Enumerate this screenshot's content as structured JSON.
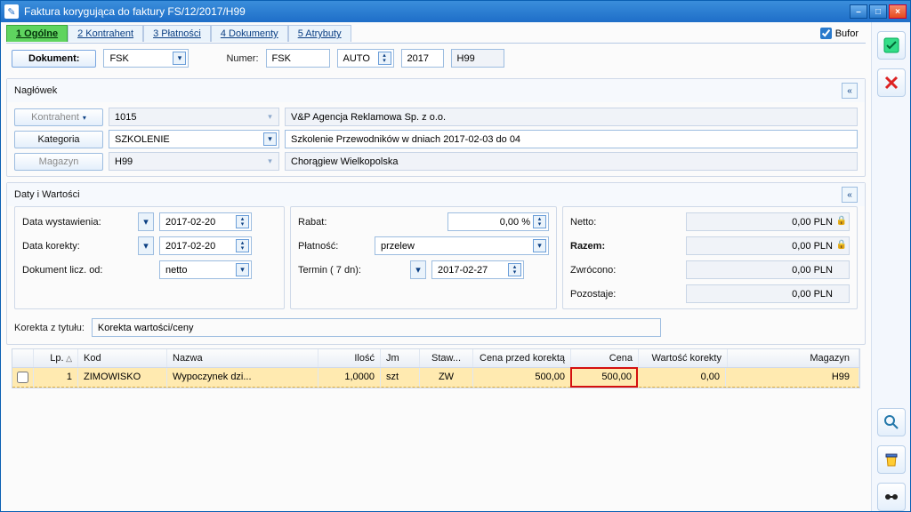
{
  "window": {
    "title": "Faktura korygująca do faktury FS/12/2017/H99"
  },
  "tabs": {
    "t1": "1 Ogólne",
    "t2": "2 Kontrahent",
    "t3": "3 Płatności",
    "t4": "4 Dokumenty",
    "t5": "5 Atrybuty"
  },
  "bufor": {
    "label": "Bufor"
  },
  "docrow": {
    "btn": "Dokument:",
    "type": "FSK",
    "numer_label": "Numer:",
    "num1": "FSK",
    "num2": "AUTO",
    "num3": "2017",
    "num4": "H99"
  },
  "naglowek": {
    "title": "Nagłówek",
    "kontrahent_btn": "Kontrahent",
    "kontrahent_code": "1015",
    "kontrahent_name": "V&P Agencja Reklamowa Sp. z o.o.",
    "kategoria_btn": "Kategoria",
    "kategoria_code": "SZKOLENIE",
    "kategoria_name": "Szkolenie Przewodników w dniach 2017-02-03 do 04",
    "magazyn_btn": "Magazyn",
    "magazyn_code": "H99",
    "magazyn_name": "Chorągiew Wielkopolska"
  },
  "daty": {
    "title": "Daty i Wartości",
    "data_wyst_label": "Data wystawienia:",
    "data_wyst": "2017-02-20",
    "data_kor_label": "Data korekty:",
    "data_kor": "2017-02-20",
    "dok_licz_label": "Dokument licz. od:",
    "dok_licz": "netto",
    "rabat_label": "Rabat:",
    "rabat": "0,00 %",
    "platnosc_label": "Płatność:",
    "platnosc": "przelew",
    "termin_label": "Termin  (    7 dn):",
    "termin": "2017-02-27",
    "netto_label": "Netto:",
    "netto": "0,00 PLN",
    "razem_label": "Razem:",
    "razem": "0,00 PLN",
    "zwrocono_label": "Zwrócono:",
    "zwrocono": "0,00 PLN",
    "pozostaje_label": "Pozostaje:",
    "pozostaje": "0,00 PLN"
  },
  "korekta": {
    "label": "Korekta z tytułu:",
    "value": "Korekta wartości/ceny"
  },
  "table": {
    "h_lp": "Lp.",
    "h_kod": "Kod",
    "h_nazwa": "Nazwa",
    "h_ilosc": "Ilość",
    "h_jm": "Jm",
    "h_staw": "Staw...",
    "h_cpk": "Cena przed korektą",
    "h_cena": "Cena",
    "h_wk": "Wartość korekty",
    "h_mag": "Magazyn",
    "rows": [
      {
        "lp": "1",
        "kod": "ZIMOWISKO",
        "nazwa": "Wypoczynek dzi...",
        "ilosc": "1,0000",
        "jm": "szt",
        "staw": "ZW",
        "cpk": "500,00",
        "cena": "500,00",
        "wk": "0,00",
        "mag": "H99"
      }
    ]
  }
}
